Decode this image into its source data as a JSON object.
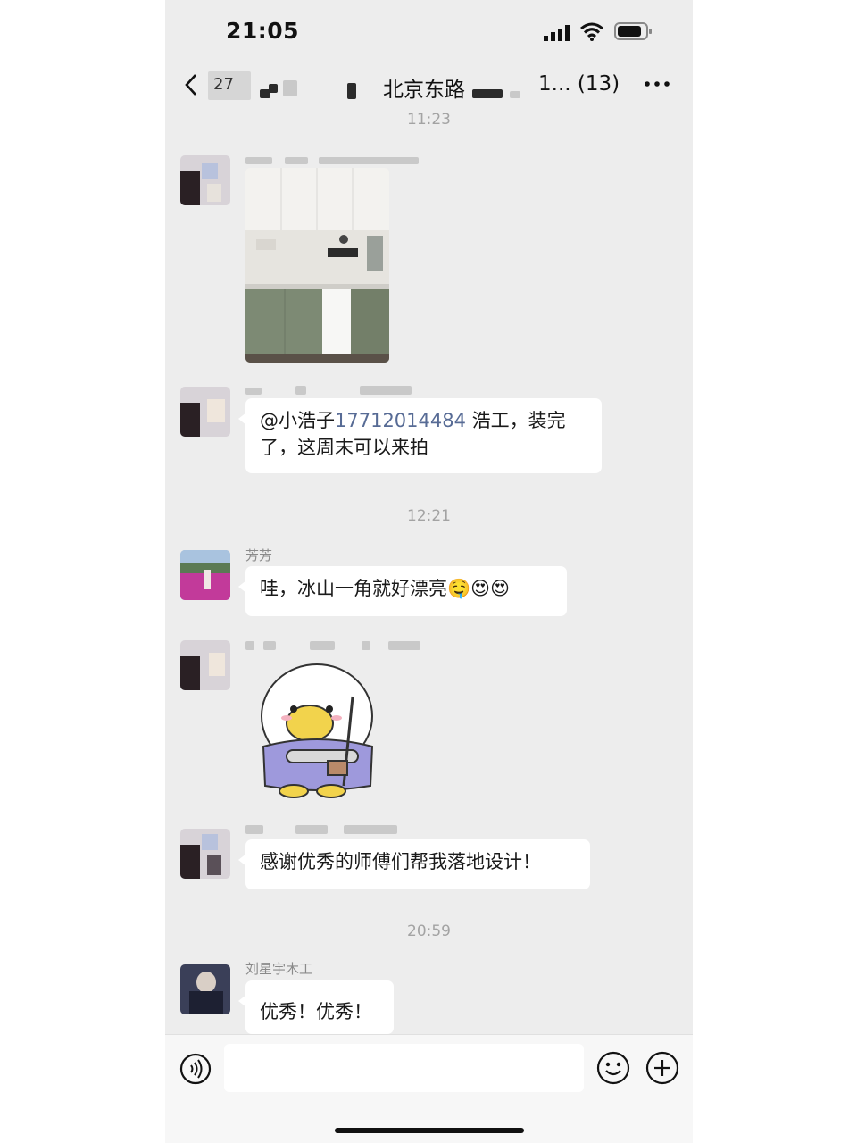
{
  "status_bar": {
    "time": "21:05"
  },
  "nav": {
    "title_prefix": "27",
    "title": "北京东路",
    "title_count": "1... (13)"
  },
  "messages": [
    {
      "timestamp": "11:23",
      "type": "image"
    },
    {
      "type": "text",
      "mention": "@小浩子",
      "phone": "17712014484",
      "text": " 浩工，装完了，这周末可以来拍"
    },
    {
      "timestamp": "12:21",
      "sender": "芳芳",
      "type": "text",
      "text": "哇，冰山一角就好漂亮",
      "emojis": [
        "🤤",
        "😍",
        "😍"
      ]
    },
    {
      "type": "sticker"
    },
    {
      "type": "text",
      "text": "感谢优秀的师傅们帮我落地设计！"
    },
    {
      "timestamp": "20:59",
      "sender": "刘星宇木工",
      "type": "text",
      "text": "优秀！优秀！"
    }
  ],
  "colors": {
    "background": "#ededed",
    "bubble": "#ffffff",
    "link": "#576b95"
  },
  "icons": [
    "back-arrow-icon",
    "more-icon",
    "voice-icon",
    "emoji-icon",
    "plus-icon"
  ]
}
